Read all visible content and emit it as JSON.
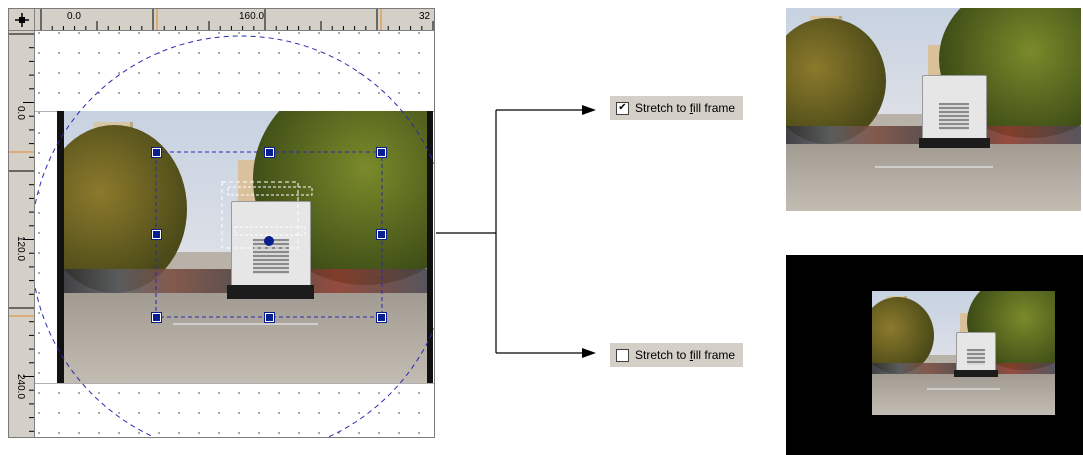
{
  "editor": {
    "ruler_top": [
      "0.0",
      "160.0",
      "32"
    ],
    "ruler_left": [
      "0.0",
      "120.0",
      "240.0"
    ]
  },
  "options": {
    "stretch_checked": {
      "label": "Stretch to fill frame",
      "mnemonic": "f",
      "checked": true
    },
    "stretch_unchecked": {
      "label": "Stretch to fill frame",
      "mnemonic": "f",
      "checked": false
    }
  },
  "colors": {
    "handle": "#0a1f8f",
    "guide": "#2a2ab0",
    "ruler_marker": "#e08a2a",
    "dialog_bg": "#d4d0c8"
  },
  "icons": {
    "ruler_corner": "crosshair-icon",
    "checkmark": "checkmark-icon",
    "arrow": "arrow-right-icon"
  }
}
